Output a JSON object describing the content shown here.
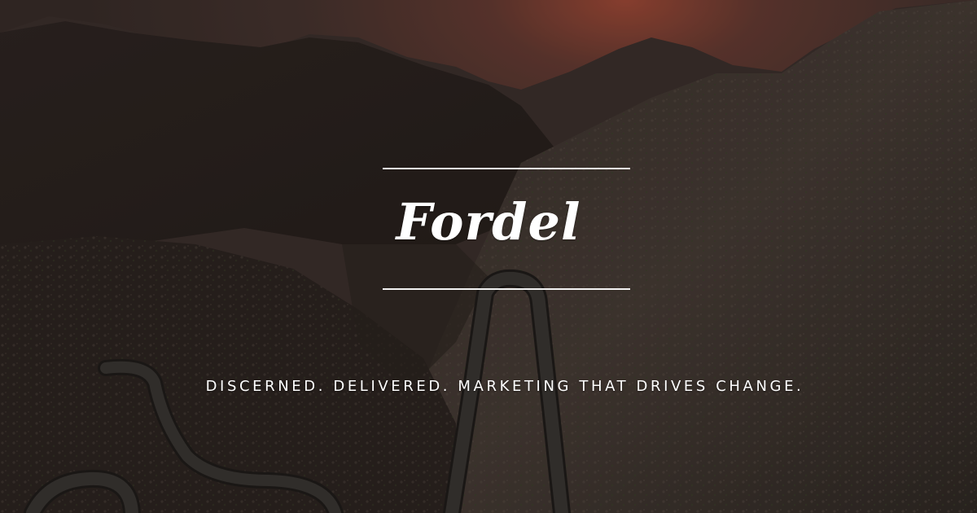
{
  "brand": {
    "logo_text": "Fordel"
  },
  "tagline": "DISCERNED. DELIVERED. MARKETING THAT DRIVES CHANGE.",
  "colors": {
    "text": "#ffffff",
    "rule": "#f2f2f2",
    "sky_glow": "#a0483a",
    "mountain_dark": "#2b2422",
    "road": "#3a3836"
  }
}
